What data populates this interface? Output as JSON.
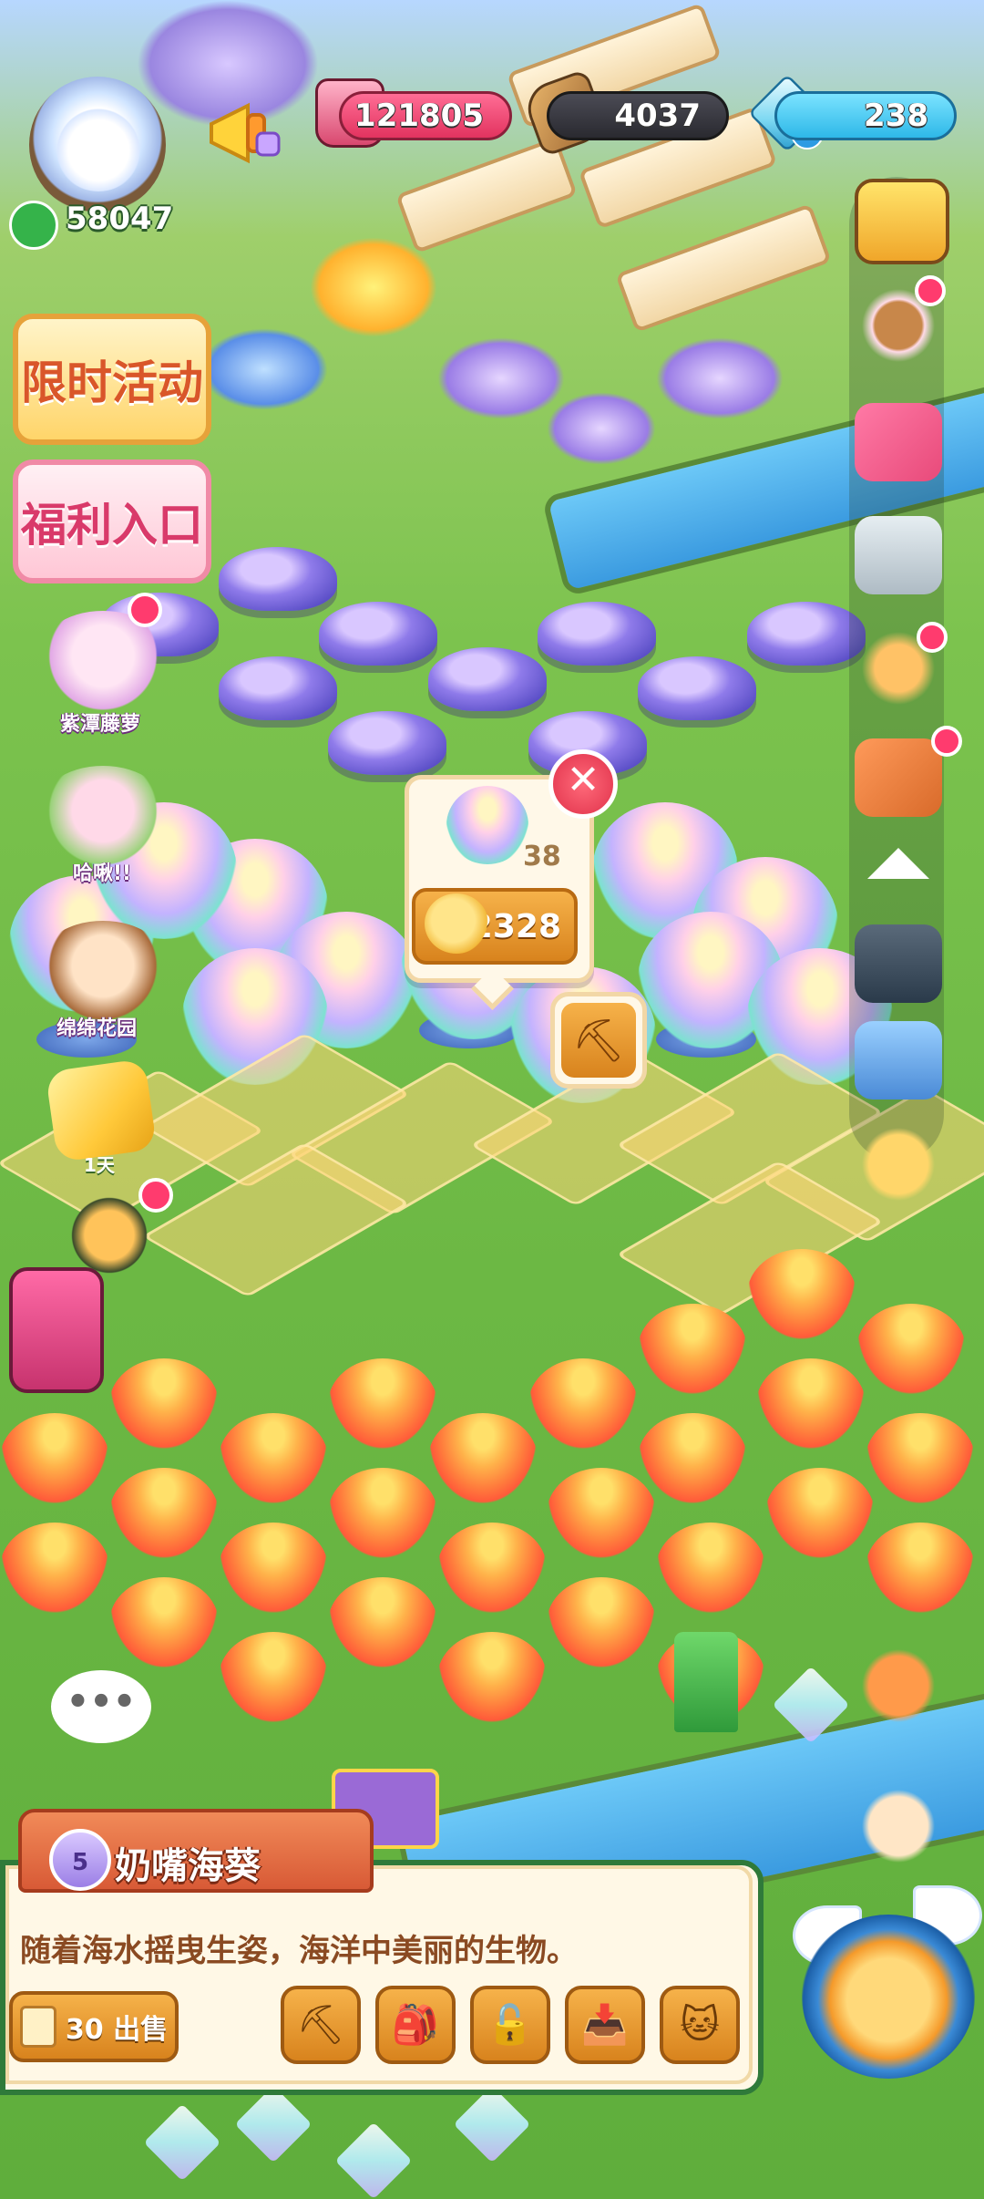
{
  "hud": {
    "player_score": "58047",
    "resources": [
      {
        "name": "jar",
        "value": "121805"
      },
      {
        "name": "wood",
        "value": "4037"
      },
      {
        "name": "gem",
        "value": "238"
      }
    ],
    "gem_plus": "+"
  },
  "left_menu": {
    "event_button": "限时活动",
    "welfare_button": "福利入口",
    "npcs": [
      {
        "label": "紫潭藤萝"
      },
      {
        "label": "哈啾!!"
      },
      {
        "label": "绵绵花园"
      }
    ],
    "ticket_label": "1天"
  },
  "item_popup": {
    "count": "38",
    "price": "2328",
    "close": "✕"
  },
  "harvest_icon": "shovel-icon",
  "chat_bubble": "•••",
  "detail_panel": {
    "level": "5",
    "item_name": "奶嘴海葵",
    "description": "随着海水摇曳生姿，海洋中美丽的生物。",
    "sell_label": "30 出售",
    "actions": [
      {
        "icon": "shovel-icon",
        "glyph": "⛏"
      },
      {
        "icon": "backpack-icon",
        "glyph": "🎒"
      },
      {
        "icon": "unlock-icon",
        "glyph": "🔓"
      },
      {
        "icon": "storage-icon",
        "glyph": "📥"
      },
      {
        "icon": "cat-icon",
        "glyph": "🐱"
      }
    ]
  },
  "colors": {
    "panel_border": "#2f7a3a",
    "panel_bg": "#fff8e6",
    "button_orange": "#e89a2e",
    "badge_red": "#ff3b6e"
  }
}
